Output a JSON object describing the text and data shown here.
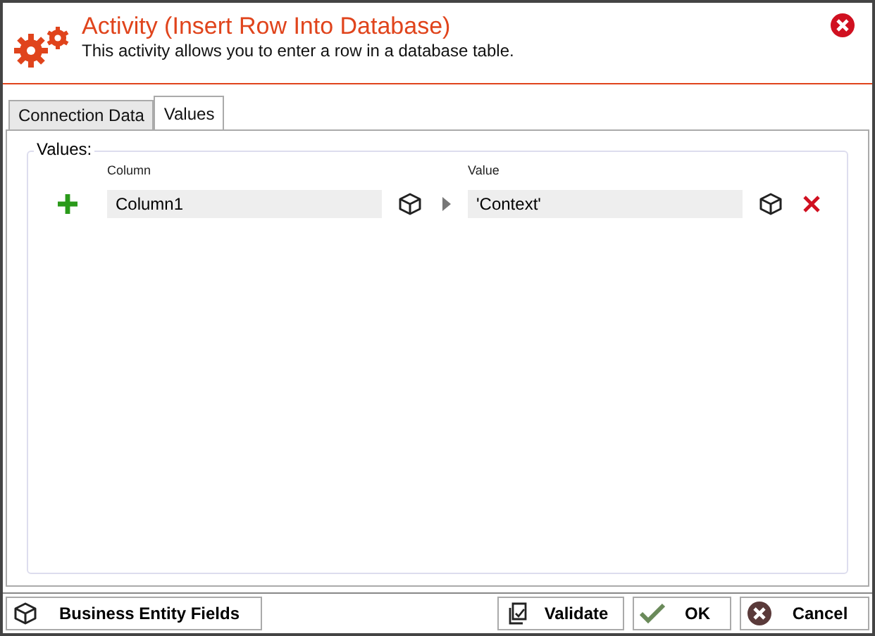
{
  "header": {
    "title": "Activity (Insert Row Into Database)",
    "description": "This activity allows you to enter a row in a database table."
  },
  "tabs": [
    {
      "label": "Connection Data",
      "selected": false
    },
    {
      "label": "Values",
      "selected": true
    }
  ],
  "group": {
    "label": "Values:",
    "column_header": "Column",
    "value_header": "Value"
  },
  "rows": [
    {
      "column": "Column1",
      "value": "'Context'"
    }
  ],
  "footer": {
    "entity_button": "Business Entity Fields",
    "validate_button": "Validate",
    "ok_button": "OK",
    "cancel_button": "Cancel"
  }
}
